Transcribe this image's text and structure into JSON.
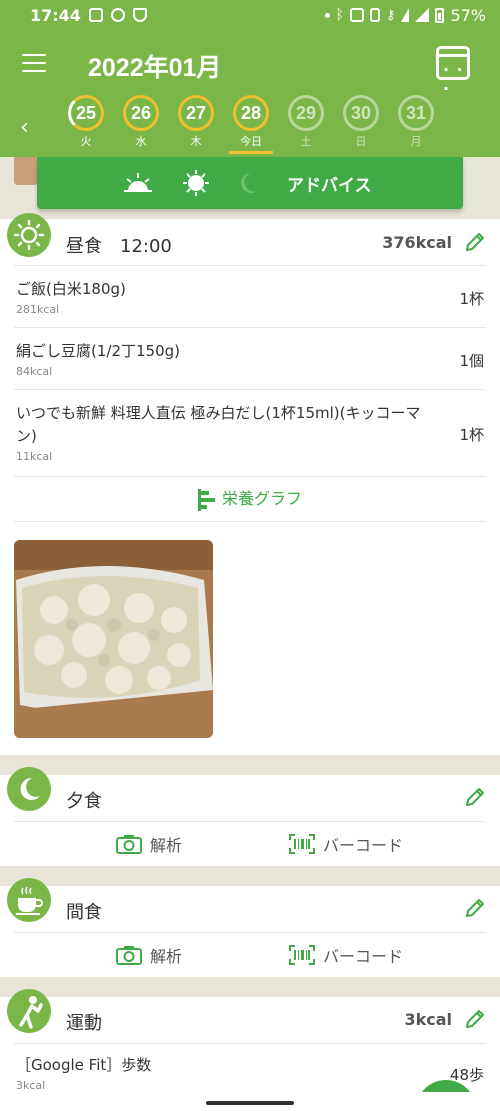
{
  "status_bar": {
    "time": "17:44",
    "battery": "57%"
  },
  "header": {
    "month": "2022年01月",
    "days": [
      {
        "num": "25",
        "weekday": "火",
        "state": "filled"
      },
      {
        "num": "26",
        "weekday": "水",
        "state": "full"
      },
      {
        "num": "27",
        "weekday": "木",
        "state": "full"
      },
      {
        "num": "28",
        "weekday": "今日",
        "state": "today"
      },
      {
        "num": "29",
        "weekday": "土",
        "state": "future"
      },
      {
        "num": "30",
        "weekday": "日",
        "state": "future"
      },
      {
        "num": "31",
        "weekday": "月",
        "state": "future"
      }
    ]
  },
  "advice": {
    "label": "アドバイス"
  },
  "lunch": {
    "title": "昼食",
    "time": "12:00",
    "kcal": "376kcal",
    "items": [
      {
        "name": "ご飯(白米180g)",
        "kcal": "281kcal",
        "qty": "1杯"
      },
      {
        "name": "絹ごし豆腐(1/2丁150g)",
        "kcal": "84kcal",
        "qty": "1個"
      },
      {
        "name": "いつでも新鮮 料理人直伝 極み白だし(1杯15ml)(キッコーマン)",
        "kcal": "11kcal",
        "qty": "1杯"
      }
    ],
    "nutrition_label": "栄養グラフ"
  },
  "dinner": {
    "title": "夕食",
    "analyze_label": "解析",
    "barcode_label": "バーコード"
  },
  "snack": {
    "title": "間食",
    "analyze_label": "解析",
    "barcode_label": "バーコード"
  },
  "exercise": {
    "title": "運動",
    "kcal": "3kcal",
    "items": [
      {
        "name": "［Google Fit］歩数",
        "kcal": "3kcal",
        "qty": "48歩"
      }
    ]
  },
  "colors": {
    "primary": "#7ab648",
    "accent": "#3faa46",
    "highlight": "#f0c030"
  }
}
